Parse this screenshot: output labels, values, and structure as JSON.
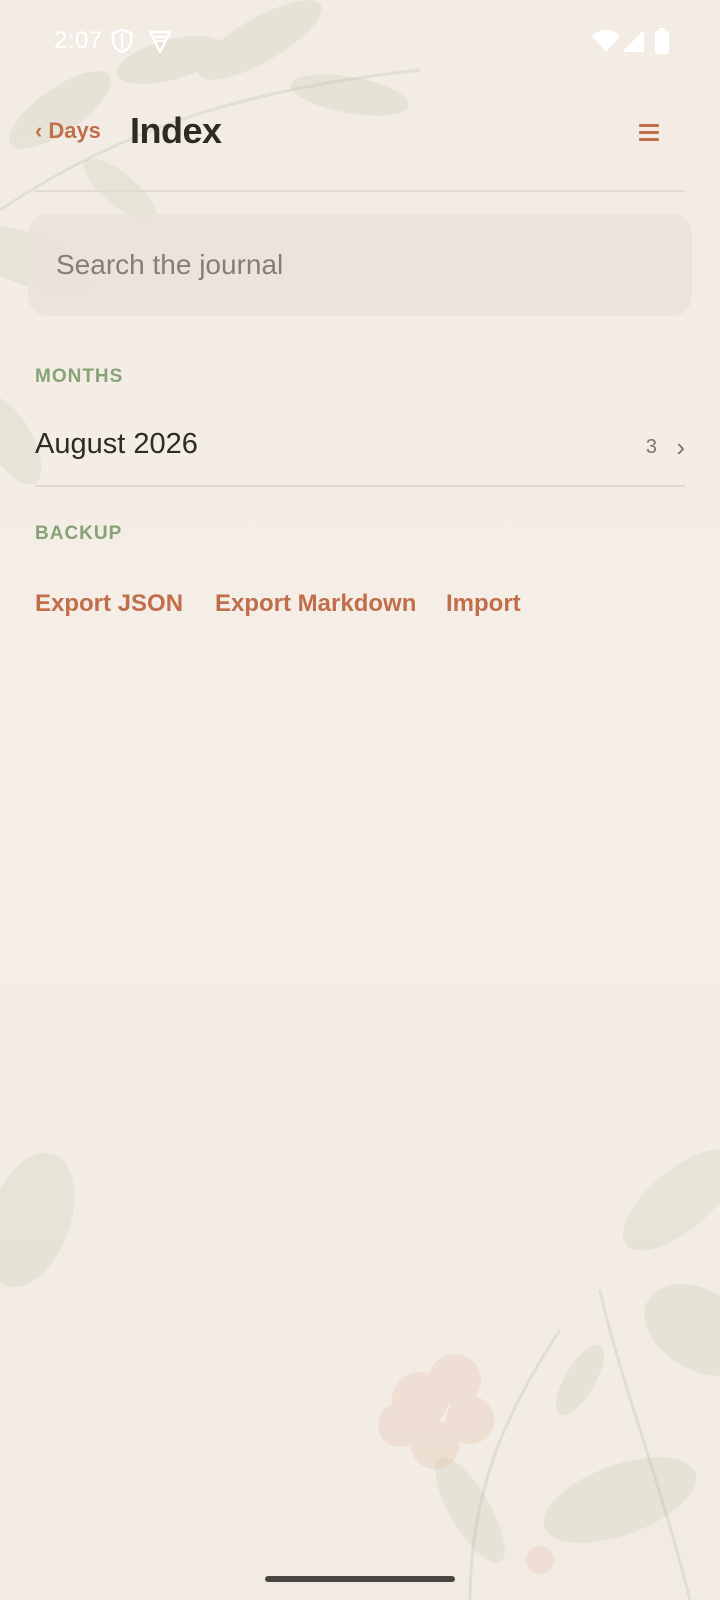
{
  "status_bar": {
    "time": "2:07",
    "left_icons": [
      "shield-icon",
      "vpn-icon"
    ],
    "right_icons": [
      "wifi-icon",
      "signal-icon",
      "battery-icon"
    ]
  },
  "header": {
    "back_label": "Days",
    "back_chevron": "‹",
    "title": "Index",
    "menu_icon": "hamburger-icon"
  },
  "search": {
    "placeholder": "Search the journal",
    "value": ""
  },
  "months": {
    "section_label": "MONTHS",
    "items": [
      {
        "label": "August 2026",
        "count": "3",
        "chevron": "›"
      }
    ]
  },
  "backup": {
    "section_label": "BACKUP",
    "actions": [
      "Export JSON",
      "Export Markdown",
      "Import"
    ]
  },
  "colors": {
    "accent": "#c16e4b",
    "section_label": "#87a277",
    "text_primary": "#2e2a26",
    "background": "#f3ede5"
  }
}
